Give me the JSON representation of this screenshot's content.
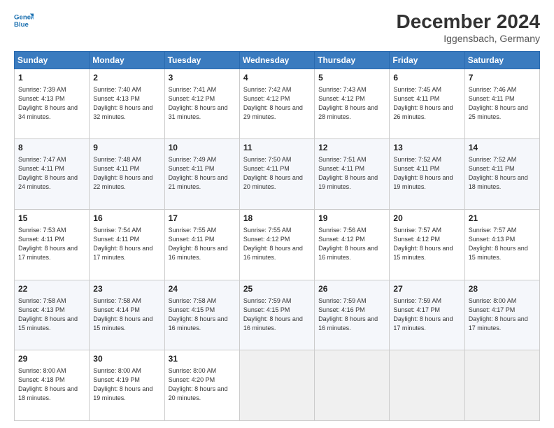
{
  "logo": {
    "line1": "General",
    "line2": "Blue"
  },
  "title": "December 2024",
  "subtitle": "Iggensbach, Germany",
  "days_header": [
    "Sunday",
    "Monday",
    "Tuesday",
    "Wednesday",
    "Thursday",
    "Friday",
    "Saturday"
  ],
  "weeks": [
    [
      {
        "day": "1",
        "sunrise": "7:39 AM",
        "sunset": "4:13 PM",
        "daylight": "8 hours and 34 minutes."
      },
      {
        "day": "2",
        "sunrise": "7:40 AM",
        "sunset": "4:13 PM",
        "daylight": "8 hours and 32 minutes."
      },
      {
        "day": "3",
        "sunrise": "7:41 AM",
        "sunset": "4:12 PM",
        "daylight": "8 hours and 31 minutes."
      },
      {
        "day": "4",
        "sunrise": "7:42 AM",
        "sunset": "4:12 PM",
        "daylight": "8 hours and 29 minutes."
      },
      {
        "day": "5",
        "sunrise": "7:43 AM",
        "sunset": "4:12 PM",
        "daylight": "8 hours and 28 minutes."
      },
      {
        "day": "6",
        "sunrise": "7:45 AM",
        "sunset": "4:11 PM",
        "daylight": "8 hours and 26 minutes."
      },
      {
        "day": "7",
        "sunrise": "7:46 AM",
        "sunset": "4:11 PM",
        "daylight": "8 hours and 25 minutes."
      }
    ],
    [
      {
        "day": "8",
        "sunrise": "7:47 AM",
        "sunset": "4:11 PM",
        "daylight": "8 hours and 24 minutes."
      },
      {
        "day": "9",
        "sunrise": "7:48 AM",
        "sunset": "4:11 PM",
        "daylight": "8 hours and 22 minutes."
      },
      {
        "day": "10",
        "sunrise": "7:49 AM",
        "sunset": "4:11 PM",
        "daylight": "8 hours and 21 minutes."
      },
      {
        "day": "11",
        "sunrise": "7:50 AM",
        "sunset": "4:11 PM",
        "daylight": "8 hours and 20 minutes."
      },
      {
        "day": "12",
        "sunrise": "7:51 AM",
        "sunset": "4:11 PM",
        "daylight": "8 hours and 19 minutes."
      },
      {
        "day": "13",
        "sunrise": "7:52 AM",
        "sunset": "4:11 PM",
        "daylight": "8 hours and 19 minutes."
      },
      {
        "day": "14",
        "sunrise": "7:52 AM",
        "sunset": "4:11 PM",
        "daylight": "8 hours and 18 minutes."
      }
    ],
    [
      {
        "day": "15",
        "sunrise": "7:53 AM",
        "sunset": "4:11 PM",
        "daylight": "8 hours and 17 minutes."
      },
      {
        "day": "16",
        "sunrise": "7:54 AM",
        "sunset": "4:11 PM",
        "daylight": "8 hours and 17 minutes."
      },
      {
        "day": "17",
        "sunrise": "7:55 AM",
        "sunset": "4:11 PM",
        "daylight": "8 hours and 16 minutes."
      },
      {
        "day": "18",
        "sunrise": "7:55 AM",
        "sunset": "4:12 PM",
        "daylight": "8 hours and 16 minutes."
      },
      {
        "day": "19",
        "sunrise": "7:56 AM",
        "sunset": "4:12 PM",
        "daylight": "8 hours and 16 minutes."
      },
      {
        "day": "20",
        "sunrise": "7:57 AM",
        "sunset": "4:12 PM",
        "daylight": "8 hours and 15 minutes."
      },
      {
        "day": "21",
        "sunrise": "7:57 AM",
        "sunset": "4:13 PM",
        "daylight": "8 hours and 15 minutes."
      }
    ],
    [
      {
        "day": "22",
        "sunrise": "7:58 AM",
        "sunset": "4:13 PM",
        "daylight": "8 hours and 15 minutes."
      },
      {
        "day": "23",
        "sunrise": "7:58 AM",
        "sunset": "4:14 PM",
        "daylight": "8 hours and 15 minutes."
      },
      {
        "day": "24",
        "sunrise": "7:58 AM",
        "sunset": "4:15 PM",
        "daylight": "8 hours and 16 minutes."
      },
      {
        "day": "25",
        "sunrise": "7:59 AM",
        "sunset": "4:15 PM",
        "daylight": "8 hours and 16 minutes."
      },
      {
        "day": "26",
        "sunrise": "7:59 AM",
        "sunset": "4:16 PM",
        "daylight": "8 hours and 16 minutes."
      },
      {
        "day": "27",
        "sunrise": "7:59 AM",
        "sunset": "4:17 PM",
        "daylight": "8 hours and 17 minutes."
      },
      {
        "day": "28",
        "sunrise": "8:00 AM",
        "sunset": "4:17 PM",
        "daylight": "8 hours and 17 minutes."
      }
    ],
    [
      {
        "day": "29",
        "sunrise": "8:00 AM",
        "sunset": "4:18 PM",
        "daylight": "8 hours and 18 minutes."
      },
      {
        "day": "30",
        "sunrise": "8:00 AM",
        "sunset": "4:19 PM",
        "daylight": "8 hours and 19 minutes."
      },
      {
        "day": "31",
        "sunrise": "8:00 AM",
        "sunset": "4:20 PM",
        "daylight": "8 hours and 20 minutes."
      },
      null,
      null,
      null,
      null
    ]
  ]
}
